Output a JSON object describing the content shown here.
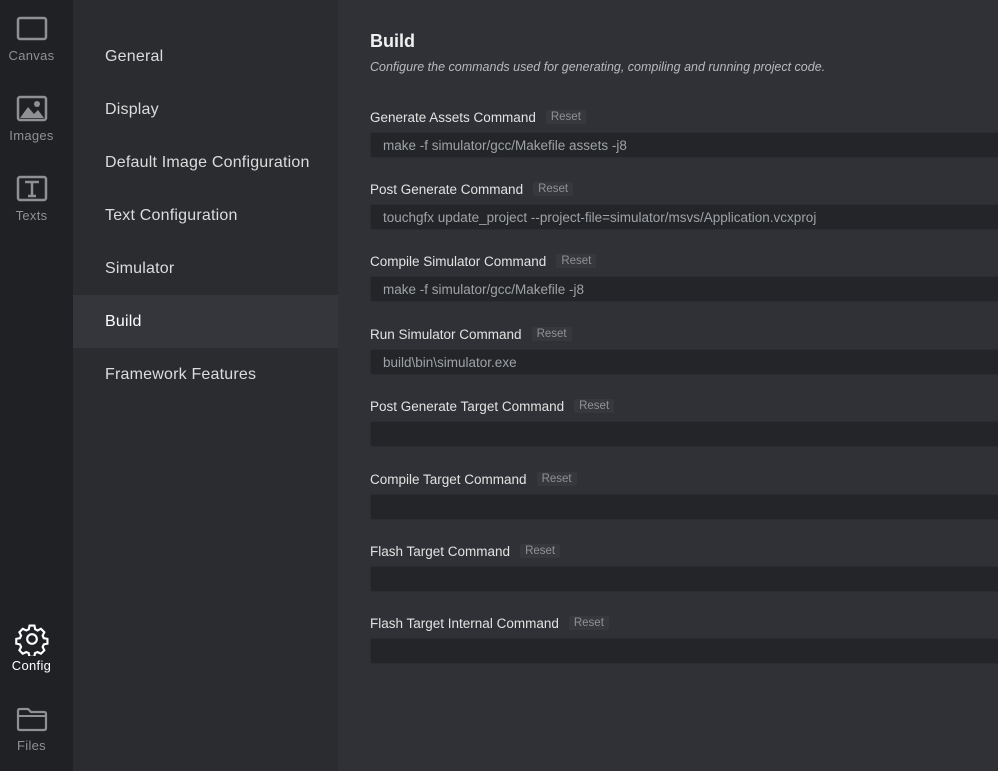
{
  "rail": {
    "canvas": "Canvas",
    "images": "Images",
    "texts": "Texts",
    "config": "Config",
    "files": "Files"
  },
  "nav": {
    "items": [
      {
        "label": "General"
      },
      {
        "label": "Display"
      },
      {
        "label": "Default Image Configuration"
      },
      {
        "label": "Text Configuration"
      },
      {
        "label": "Simulator"
      },
      {
        "label": "Build"
      },
      {
        "label": "Framework Features"
      }
    ],
    "active": "Build"
  },
  "build": {
    "title": "Build",
    "subtitle": "Configure the commands used for generating, compiling and running project code.",
    "reset_label": "Reset",
    "fields": [
      {
        "label": "Generate Assets Command",
        "value": "make -f simulator/gcc/Makefile assets -j8"
      },
      {
        "label": "Post Generate Command",
        "value": "touchgfx update_project --project-file=simulator/msvs/Application.vcxproj"
      },
      {
        "label": "Compile Simulator Command",
        "value": "make -f simulator/gcc/Makefile -j8"
      },
      {
        "label": "Run Simulator Command",
        "value": "build\\bin\\simulator.exe"
      },
      {
        "label": "Post Generate Target Command",
        "value": ""
      },
      {
        "label": "Compile Target Command",
        "value": ""
      },
      {
        "label": "Flash Target Command",
        "value": ""
      },
      {
        "label": "Flash Target Internal Command",
        "value": ""
      }
    ]
  },
  "colors": {
    "rail_bg": "#1f2124",
    "nav_bg": "#2a2c30",
    "nav_active_bg": "#34363b",
    "main_bg": "#2f3136",
    "input_bg": "#232528"
  }
}
